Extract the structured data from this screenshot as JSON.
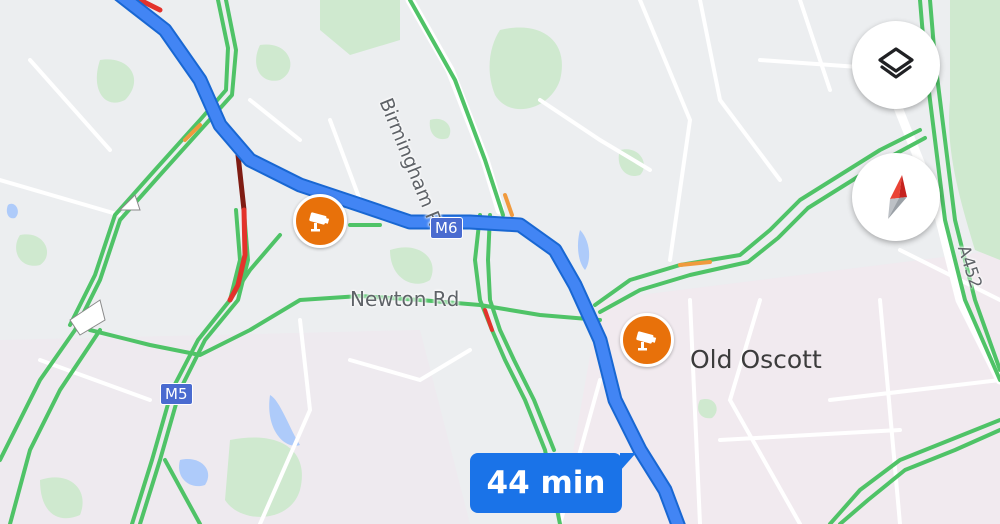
{
  "map": {
    "places": [
      {
        "name": "Old Oscott"
      }
    ],
    "roads": {
      "birmingham_rd": "Birmingham Rd",
      "newton_rd": "Newton Rd",
      "a452": "A452"
    },
    "shields": {
      "m6": "M6",
      "m5": "M5"
    },
    "route": {
      "eta": "44 min",
      "color": "#4285f4"
    },
    "traffic_colors": {
      "free_flow": "#4fc367",
      "slow": "#f09a3e",
      "heavy": "#e3322b",
      "severe": "#7f1c13"
    },
    "speed_cameras": [
      {
        "icon": "speed-camera-icon"
      },
      {
        "icon": "speed-camera-icon"
      }
    ]
  },
  "controls": {
    "layers_icon": "layers-icon",
    "compass_icon": "compass-icon"
  }
}
